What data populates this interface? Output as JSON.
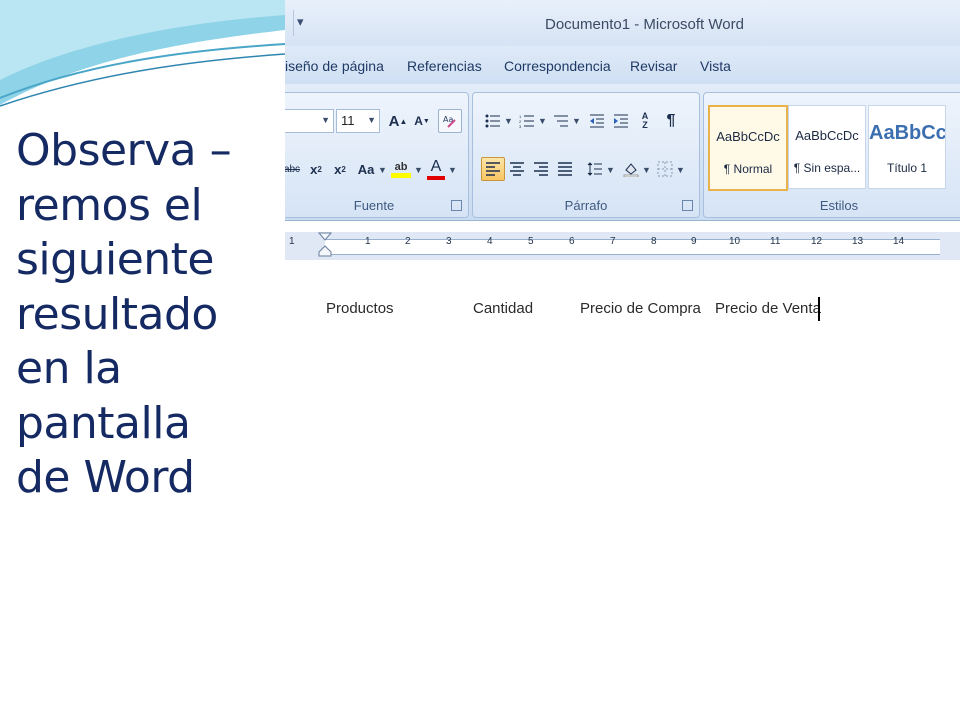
{
  "slide": {
    "lines": [
      "Observa –",
      "remos el",
      "siguiente",
      "resultado",
      "en la",
      "pantalla",
      "de Word"
    ]
  },
  "window": {
    "title": "Documento1 - Microsoft Word"
  },
  "tabs": [
    "iseño de página",
    "Referencias",
    "Correspondencia",
    "Revisar",
    "Vista"
  ],
  "ribbon": {
    "font_group": {
      "label": "Fuente",
      "font_size": "11"
    },
    "paragraph_group": {
      "label": "Párrafo"
    },
    "styles_group": {
      "label": "Estilos",
      "styles": [
        {
          "sample": "AaBbCcDc",
          "name": "¶ Normal"
        },
        {
          "sample": "AaBbCcDc",
          "name": "¶ Sin espa..."
        },
        {
          "sample": "AaBbCc",
          "name": "Título 1"
        }
      ]
    }
  },
  "ruler": {
    "numbers": [
      "1",
      "1",
      "2",
      "3",
      "4",
      "5",
      "6",
      "7",
      "8",
      "9",
      "10",
      "11",
      "12",
      "13",
      "14"
    ]
  },
  "document": {
    "columns": [
      "Productos",
      "Cantidad",
      "Precio de Compra",
      "Precio de Venta"
    ]
  },
  "colors": {
    "slide_text": "#152a63",
    "highlight": "#ffff00",
    "font_color": "#e00000",
    "active_button": "#f8c562"
  }
}
